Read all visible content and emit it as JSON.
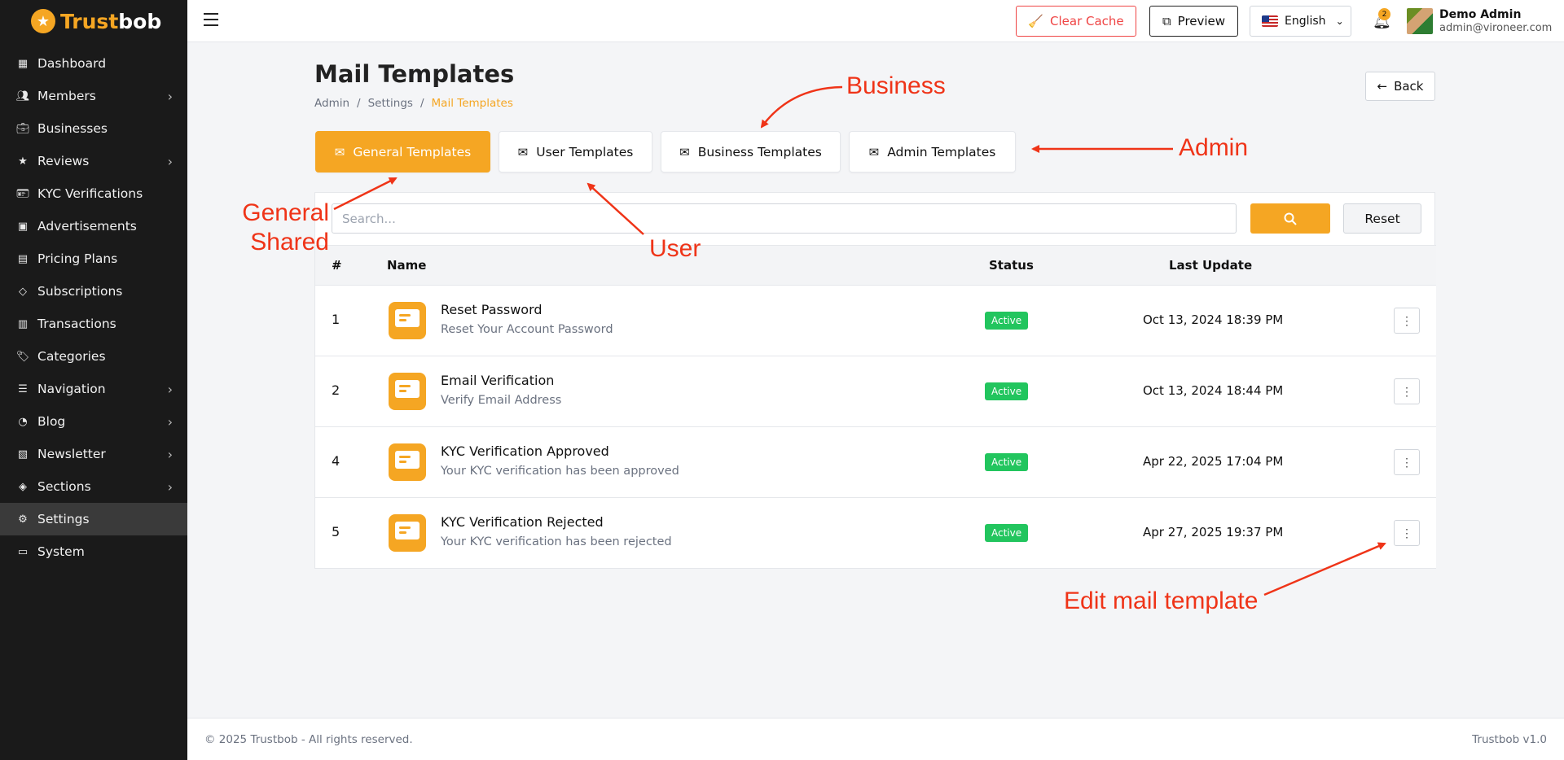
{
  "brand": {
    "prefix": "Trust",
    "suffix": "bob"
  },
  "sidebar": {
    "items": [
      {
        "label": "Dashboard",
        "icon": "dashboard-icon",
        "chevron": false,
        "active": false
      },
      {
        "label": "Members",
        "icon": "users-icon",
        "chevron": true,
        "active": false
      },
      {
        "label": "Businesses",
        "icon": "briefcase-icon",
        "chevron": false,
        "active": false
      },
      {
        "label": "Reviews",
        "icon": "star-icon",
        "chevron": true,
        "active": false
      },
      {
        "label": "KYC Verifications",
        "icon": "id-card-icon",
        "chevron": false,
        "active": false
      },
      {
        "label": "Advertisements",
        "icon": "ad-icon",
        "chevron": false,
        "active": false
      },
      {
        "label": "Pricing Plans",
        "icon": "pricing-icon",
        "chevron": false,
        "active": false
      },
      {
        "label": "Subscriptions",
        "icon": "diamond-icon",
        "chevron": false,
        "active": false
      },
      {
        "label": "Transactions",
        "icon": "receipt-icon",
        "chevron": false,
        "active": false
      },
      {
        "label": "Categories",
        "icon": "tags-icon",
        "chevron": false,
        "active": false
      },
      {
        "label": "Navigation",
        "icon": "list-icon",
        "chevron": true,
        "active": false
      },
      {
        "label": "Blog",
        "icon": "rss-icon",
        "chevron": true,
        "active": false
      },
      {
        "label": "Newsletter",
        "icon": "inbox-icon",
        "chevron": true,
        "active": false
      },
      {
        "label": "Sections",
        "icon": "layers-icon",
        "chevron": true,
        "active": false
      },
      {
        "label": "Settings",
        "icon": "gear-icon",
        "chevron": false,
        "active": true
      },
      {
        "label": "System",
        "icon": "server-icon",
        "chevron": false,
        "active": false
      }
    ]
  },
  "topbar": {
    "clear_cache": "Clear Cache",
    "preview": "Preview",
    "language": "English",
    "notification_count": "2",
    "user_name": "Demo Admin",
    "user_email": "admin@vironеer.com"
  },
  "page": {
    "title": "Mail Templates",
    "breadcrumb": [
      "Admin",
      "Settings",
      "Mail Templates"
    ],
    "back": "Back"
  },
  "tabs": [
    {
      "label": "General Templates",
      "active": true
    },
    {
      "label": "User Templates",
      "active": false
    },
    {
      "label": "Business Templates",
      "active": false
    },
    {
      "label": "Admin Templates",
      "active": false
    }
  ],
  "search": {
    "placeholder": "Search...",
    "reset": "Reset"
  },
  "table": {
    "headers": {
      "num": "#",
      "name": "Name",
      "status": "Status",
      "last_update": "Last Update"
    },
    "rows": [
      {
        "num": "1",
        "title": "Reset Password",
        "subtitle": "Reset Your Account Password",
        "status": "Active",
        "date": "Oct 13, 2024 18:39 PM"
      },
      {
        "num": "2",
        "title": "Email Verification",
        "subtitle": "Verify Email Address",
        "status": "Active",
        "date": "Oct 13, 2024 18:44 PM"
      },
      {
        "num": "4",
        "title": "KYC Verification Approved",
        "subtitle": "Your KYC verification has been approved",
        "status": "Active",
        "date": "Apr 22, 2025 17:04 PM"
      },
      {
        "num": "5",
        "title": "KYC Verification Rejected",
        "subtitle": "Your KYC verification has been rejected",
        "status": "Active",
        "date": "Apr 27, 2025 19:37 PM"
      }
    ]
  },
  "annotations": {
    "business": "Business",
    "admin": "Admin",
    "general_line1": "General",
    "general_line2": "Shared",
    "user": "User",
    "edit": "Edit mail template"
  },
  "footer": {
    "copyright": "© 2025 Trustbob - All rights reserved.",
    "version": "Trustbob v1.0"
  },
  "colors": {
    "accent": "#f5a623",
    "sidebar_bg": "#1a1a1a",
    "annotation": "#ef3418",
    "status_active": "#22c55e",
    "danger": "#ef4444"
  }
}
